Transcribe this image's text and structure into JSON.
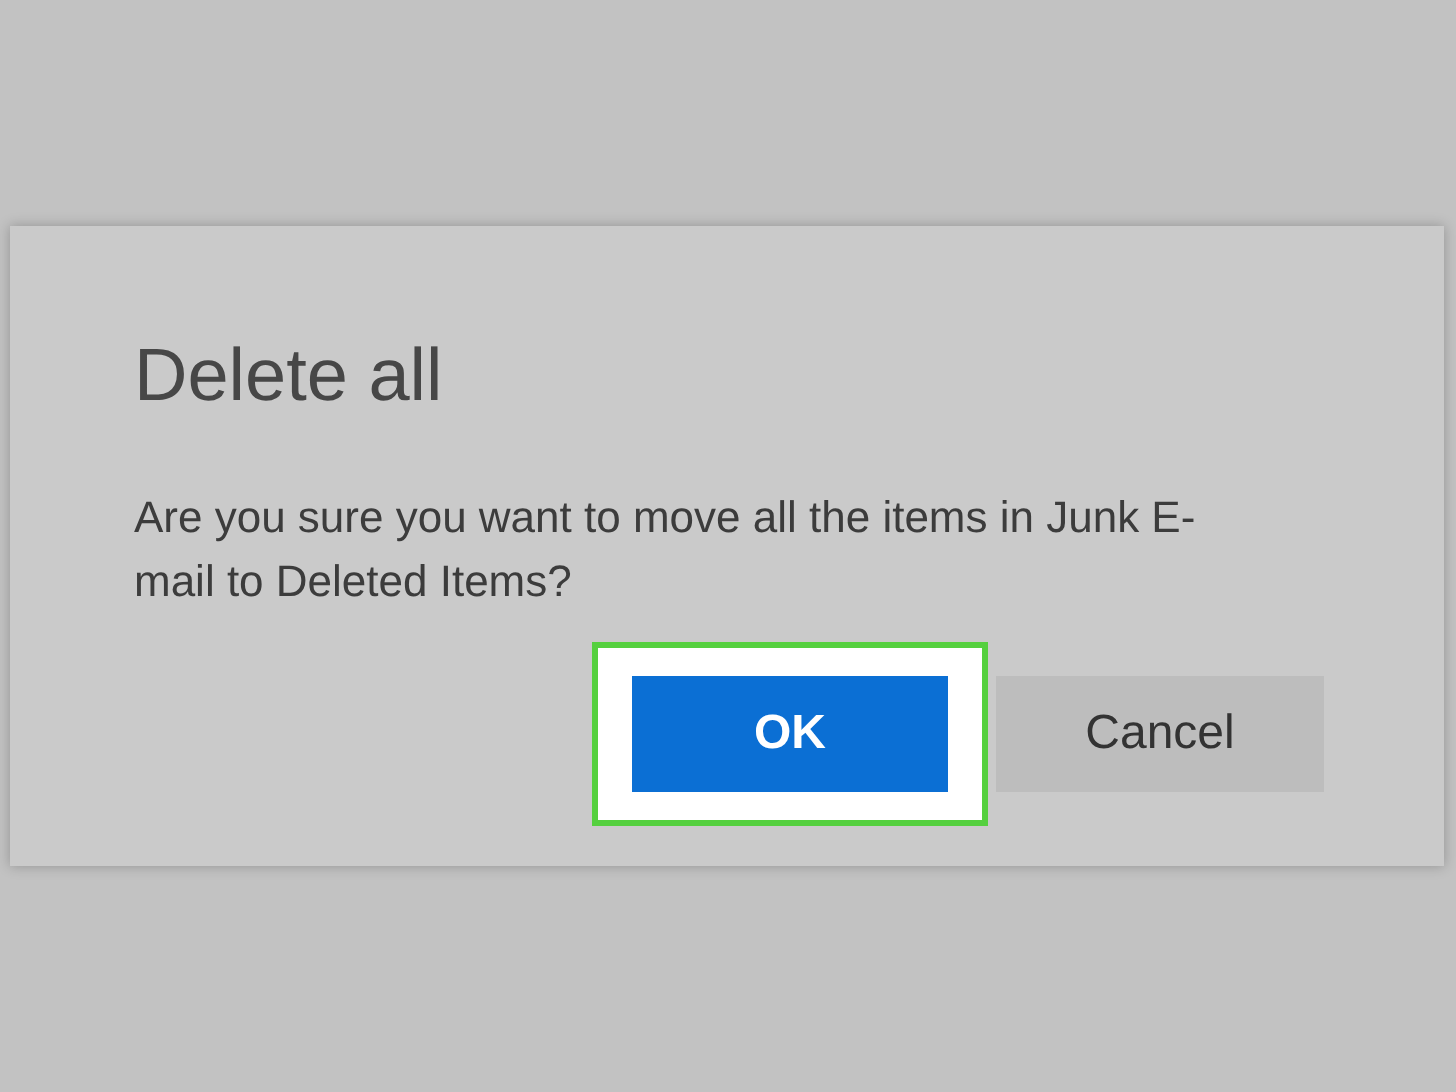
{
  "dialog": {
    "title": "Delete all",
    "message": "Are you sure you want to move all the items in Junk E-mail to Deleted Items?",
    "buttons": [
      {
        "label": "OK",
        "kind": "primary",
        "highlighted": true
      },
      {
        "label": "Cancel",
        "kind": "secondary",
        "highlighted": false
      }
    ]
  }
}
